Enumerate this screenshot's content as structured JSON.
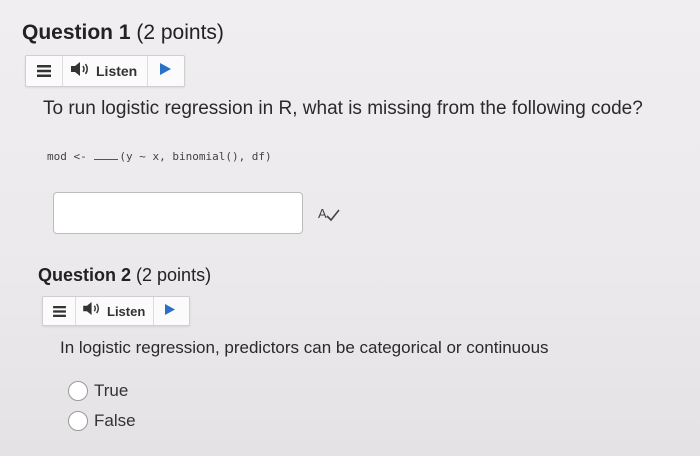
{
  "q1": {
    "number": "Question 1",
    "points": "(2 points)",
    "listen_label": "Listen",
    "prompt": "To run logistic regression in R, what is missing from the following code?",
    "code_before": "mod <- ",
    "code_after": "(y ~ x, binomial(), df)",
    "answer_value": ""
  },
  "q2": {
    "number": "Question 2",
    "points": "(2 points)",
    "listen_label": "Listen",
    "prompt": "In logistic regression, predictors can be categorical or continuous",
    "options": [
      "True",
      "False"
    ]
  },
  "icons": {
    "menu": "menu-icon",
    "speaker": "speaker-icon",
    "play": "play-icon",
    "spellcheck": "spellcheck-icon"
  }
}
